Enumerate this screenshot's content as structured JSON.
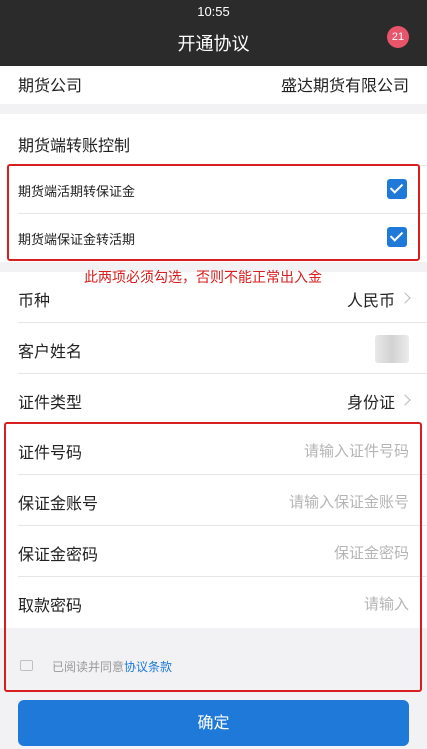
{
  "status_bar": {
    "time": "10:55"
  },
  "header": {
    "title": "开通协议",
    "badge": "21"
  },
  "company": {
    "label": "期货公司",
    "value": "盛达期货有限公司"
  },
  "transfer_control": {
    "title": "期货端转账控制",
    "options": [
      {
        "label": "期货端活期转保证金",
        "checked": true
      },
      {
        "label": "期货端保证金转活期",
        "checked": true
      }
    ]
  },
  "annotation": "此两项必须勾选，否则不能正常出入金",
  "form": {
    "currency": {
      "label": "币种",
      "value": "人民币"
    },
    "customer_name": {
      "label": "客户姓名"
    },
    "id_type": {
      "label": "证件类型",
      "value": "身份证"
    },
    "id_number": {
      "label": "证件号码",
      "placeholder": "请输入证件号码"
    },
    "margin_account": {
      "label": "保证金账号",
      "placeholder": "请输入保证金账号"
    },
    "margin_password": {
      "label": "保证金密码",
      "placeholder": "保证金密码"
    },
    "withdraw_password": {
      "label": "取款密码",
      "placeholder": "请输入"
    }
  },
  "agreement": {
    "prefix": "已阅读并同意",
    "link": "协议条款"
  },
  "confirm_button": "确定",
  "colors": {
    "accent": "#1e79d9",
    "annotation_red": "#d81e1e",
    "nav_bg": "#2b2b2b"
  }
}
